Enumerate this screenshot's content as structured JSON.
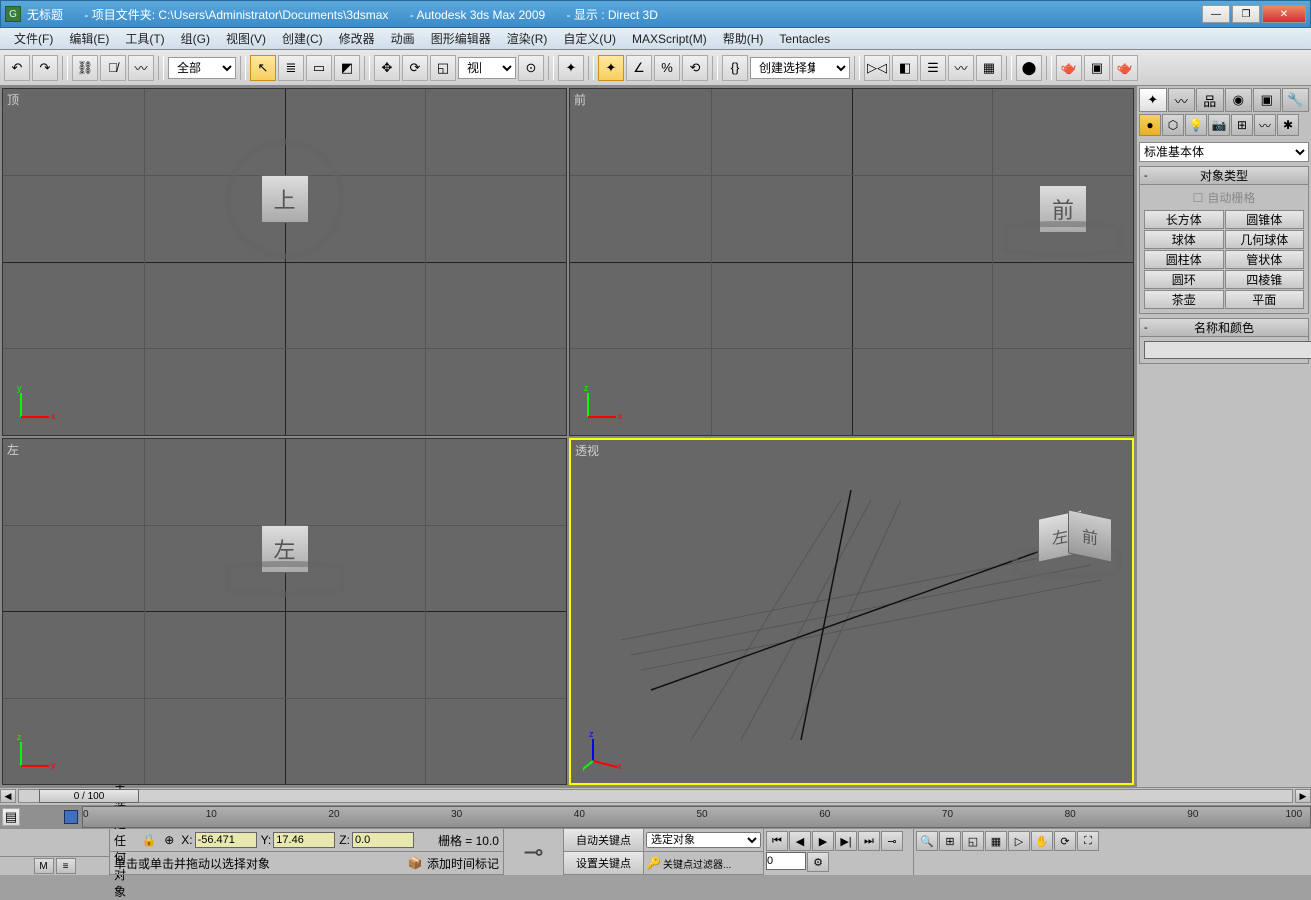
{
  "titlebar": {
    "untitled": "无标题",
    "project_label": "- 项目文件夹: C:\\Users\\Administrator\\Documents\\3dsmax",
    "app": "- Autodesk 3ds Max  2009",
    "display": "- 显示 : Direct 3D"
  },
  "menu": [
    "文件(F)",
    "编辑(E)",
    "工具(T)",
    "组(G)",
    "视图(V)",
    "创建(C)",
    "修改器",
    "动画",
    "图形编辑器",
    "渲染(R)",
    "自定义(U)",
    "MAXScript(M)",
    "帮助(H)",
    "Tentacles"
  ],
  "toolbar": {
    "filter_all": "全部",
    "view_select": "视图",
    "named_set": "创建选择集"
  },
  "viewports": {
    "top": "顶",
    "front": "前",
    "left": "左",
    "perspective": "透视",
    "cube_top": "上",
    "cube_front": "前",
    "cube_left": "左"
  },
  "cmdpanel": {
    "category": "标准基本体",
    "rollout_objtype": "对象类型",
    "autogrid": "自动栅格",
    "objects": [
      "长方体",
      "圆锥体",
      "球体",
      "几何球体",
      "圆柱体",
      "管状体",
      "圆环",
      "四棱锥",
      "茶壶",
      "平面"
    ],
    "rollout_name": "名称和颜色"
  },
  "timeline": {
    "frame_display": "0 / 100",
    "ticks": [
      "0",
      "10",
      "20",
      "30",
      "40",
      "50",
      "60",
      "70",
      "80",
      "90",
      "100"
    ]
  },
  "status": {
    "no_selection": "未选定任何对象",
    "hint": "单击或单击并拖动以选择对象",
    "x_label": "X:",
    "x_val": "-56.471",
    "y_label": "Y:",
    "y_val": "17.46",
    "z_label": "Z:",
    "z_val": "0.0",
    "grid": "栅格 = 10.0",
    "add_tag": "添加时间标记",
    "autokey": "自动关键点",
    "setkey": "设置关键点",
    "sel_obj": "选定对象",
    "key_filter": "关键点过滤器...",
    "frame_input": "0"
  }
}
